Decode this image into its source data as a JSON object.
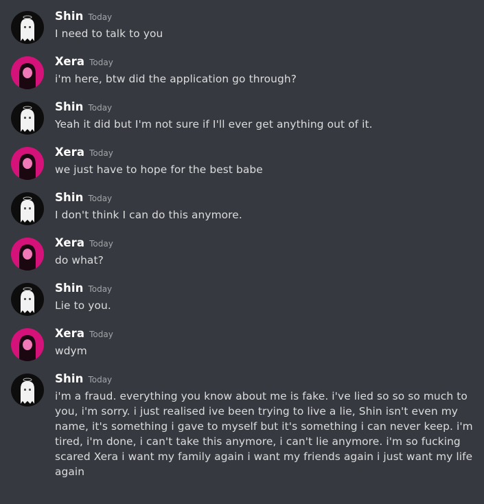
{
  "messages": [
    {
      "author": "Shin",
      "timestamp": "Today",
      "text": "I need to talk to you",
      "avatar": "shin-ghost-avatar"
    },
    {
      "author": "Xera",
      "timestamp": "Today",
      "text": "i'm here, btw did the application go through?",
      "avatar": "xera-pink-avatar"
    },
    {
      "author": "Shin",
      "timestamp": "Today",
      "text": "Yeah it did but I'm not sure if I'll ever get anything out of it.",
      "avatar": "shin-ghost-avatar"
    },
    {
      "author": "Xera",
      "timestamp": "Today",
      "text": "we just have to hope for the best babe",
      "avatar": "xera-pink-avatar"
    },
    {
      "author": "Shin",
      "timestamp": "Today",
      "text": "I don't think I can do this anymore.",
      "avatar": "shin-ghost-avatar"
    },
    {
      "author": "Xera",
      "timestamp": "Today",
      "text": "do what?",
      "avatar": "xera-pink-avatar"
    },
    {
      "author": "Shin",
      "timestamp": "Today",
      "text": "Lie to you.",
      "avatar": "shin-ghost-avatar"
    },
    {
      "author": "Xera",
      "timestamp": "Today",
      "text": "wdym",
      "avatar": "xera-pink-avatar"
    },
    {
      "author": "Shin",
      "timestamp": "Today",
      "text": "i'm a fraud. everything you know about me is fake. i've lied so so so much to you, i'm sorry. i just realised ive been trying to live a lie, Shin isn't even my name, it's something i gave to myself but it's something i can never keep. i'm tired, i'm done, i can't take this anymore, i can't lie anymore. i'm so fucking scared Xera i want my family again i want my friends again i just want my life again",
      "avatar": "shin-ghost-avatar"
    }
  ],
  "colors": {
    "background": "#36393f",
    "username": "#ffffff",
    "timestamp": "#a3a6aa",
    "message_text": "#dcddde",
    "xera_avatar_accent": "#d4127a"
  }
}
